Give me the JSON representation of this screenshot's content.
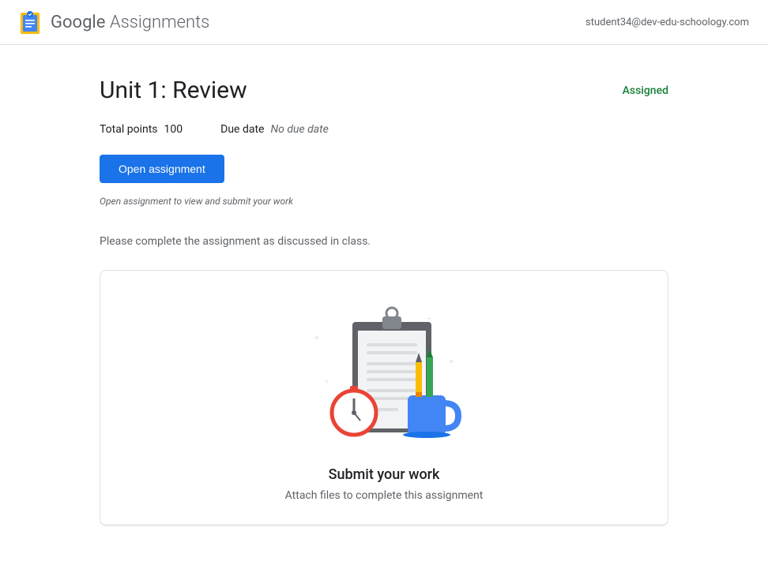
{
  "header": {
    "product_google": "Google",
    "product_assignments": " Assignments",
    "user_email": "student34@dev-edu-schoology.com"
  },
  "assignment": {
    "title": "Unit 1: Review",
    "status": "Assigned",
    "points_label": "Total points",
    "points_value": "100",
    "due_label": "Due date",
    "due_value": "No due date",
    "open_button": "Open assignment",
    "helper_text": "Open assignment to view and submit your work",
    "description": "Please complete the assignment as discussed in class."
  },
  "submit_card": {
    "title": "Submit your work",
    "subtitle": "Attach files to complete this assignment"
  }
}
